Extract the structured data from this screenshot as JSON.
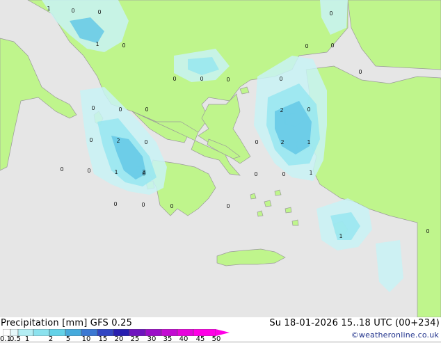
{
  "title_left": "Precipitation [mm]  GFS 0.25",
  "title_right": "Su 18-01-2026 15..18 UTC (00+234)",
  "credit": "©weatheronline.co.uk",
  "colors": {
    "sea": "#e6e6e6",
    "land": "#bff58c",
    "precip_light": "#c8f2f5",
    "precip_mid": "#96e6f0",
    "precip_heavy": "#64c8e6",
    "coast": "#9a9a9a"
  },
  "legend": {
    "ticks": [
      "0.1",
      "0.5",
      "1",
      "2",
      "5",
      "10",
      "15",
      "20",
      "25",
      "30",
      "35",
      "40",
      "45",
      "50"
    ],
    "colors": [
      "#ffffff",
      "#e6f8fa",
      "#b4eef4",
      "#8ce2ee",
      "#64d2e8",
      "#46aadc",
      "#3c78d2",
      "#3246c3",
      "#281eaf",
      "#6e14be",
      "#9b0fc8",
      "#c30ad2",
      "#e605dc",
      "#ff00e6"
    ]
  },
  "value_labels": [
    "1",
    "0",
    "0",
    "1",
    "0",
    "0",
    "0",
    "0",
    "0",
    "0",
    "0",
    "0",
    "0",
    "0",
    "0",
    "0",
    "0",
    "2",
    "0",
    "0",
    "2",
    "0",
    "2",
    "1",
    "0",
    "0",
    "1",
    "0",
    "0",
    "0",
    "1",
    "2",
    "0",
    "0",
    "0",
    "0",
    "1",
    "0"
  ]
}
